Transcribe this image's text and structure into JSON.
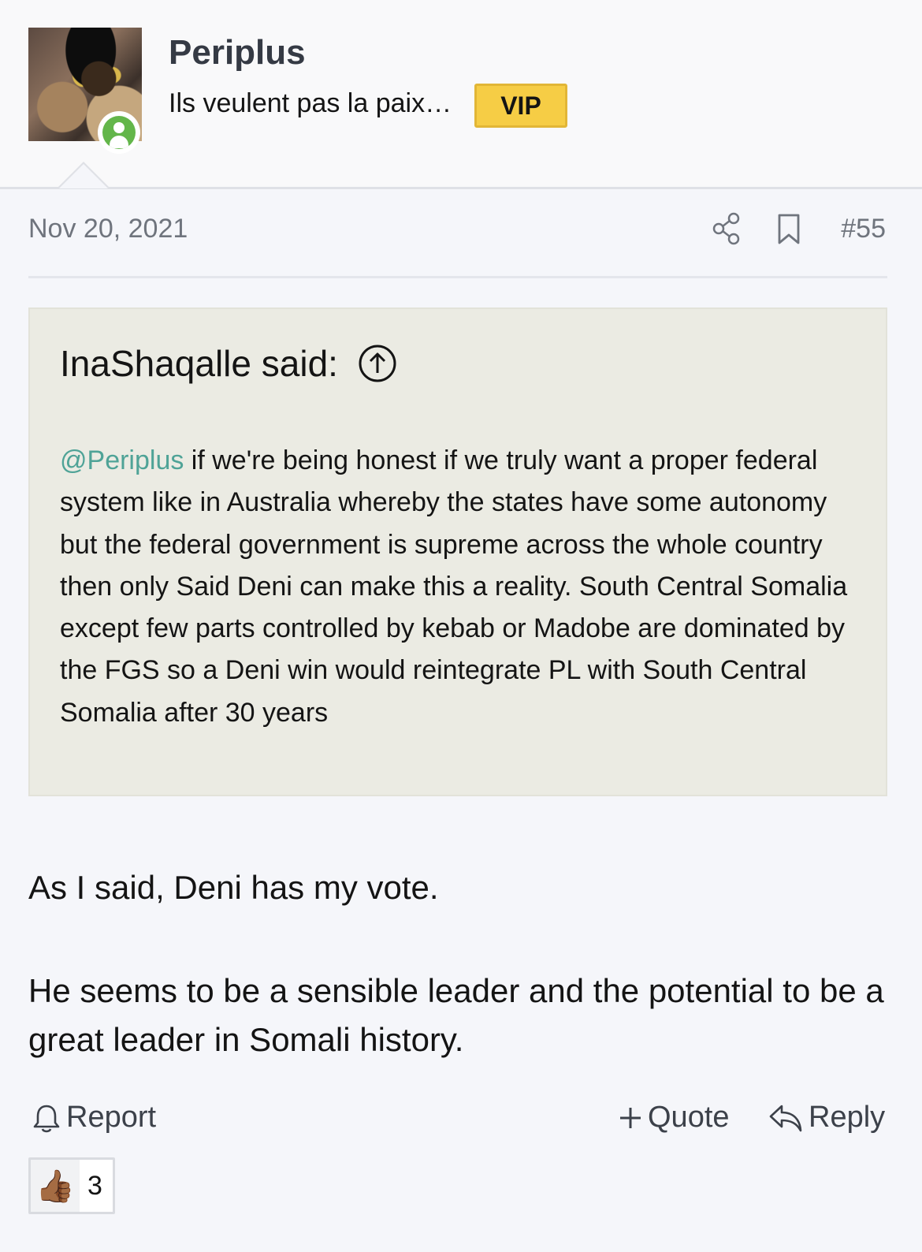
{
  "post": {
    "author": {
      "name": "Periplus",
      "title": "Ils veulent pas la paix…",
      "badge": "VIP",
      "status": "online"
    },
    "date": "Nov 20, 2021",
    "number": "#55",
    "quote": {
      "header": "InaShaqalle said:",
      "mention": "@Periplus",
      "text": " if we're being honest if we truly want a proper federal system like in Australia whereby the states have some autonomy but the federal government is supreme across the whole country then only Said Deni can make this a reality. South Central Somalia except few parts controlled by kebab or Madobe are dominated by the FGS so a Deni win would reintegrate PL with South Central Somalia after 30 years"
    },
    "body": {
      "p1": "As I said, Deni has my vote.",
      "p2": "He seems to be a sensible leader and the potential to be a great leader in Somali history."
    },
    "actions": {
      "report": "Report",
      "quote": "Quote",
      "reply": "Reply"
    },
    "reaction": {
      "emoji": "👍🏾",
      "count": "3"
    }
  },
  "colors": {
    "accent_vip": "#f6cd45",
    "mention": "#4fa397",
    "online": "#63b64a"
  },
  "icons": [
    "online-user-icon",
    "share-icon",
    "bookmark-icon",
    "jump-up-icon",
    "bell-icon",
    "plus-icon",
    "reply-arrow-icon"
  ]
}
